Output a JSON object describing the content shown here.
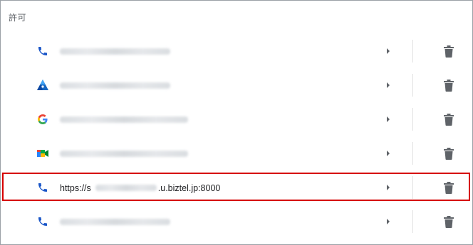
{
  "section": {
    "label": "許可"
  },
  "rows": [
    {
      "icon": "phone-icon",
      "url_prefix": "",
      "url_suffix": "",
      "redacted": true
    },
    {
      "icon": "pen-triangle-icon",
      "url_prefix": "",
      "url_suffix": "",
      "redacted": true
    },
    {
      "icon": "google-g-icon",
      "url_prefix": "",
      "url_suffix": "",
      "redacted": true
    },
    {
      "icon": "meet-camera-icon",
      "url_prefix": "",
      "url_suffix": "",
      "redacted": true
    },
    {
      "icon": "phone-icon",
      "url_prefix": "https://s",
      "url_suffix": ".u.biztel.jp:8000",
      "redacted": false,
      "highlighted": true
    },
    {
      "icon": "phone-icon",
      "url_prefix": "",
      "url_suffix": "",
      "redacted": true
    }
  ],
  "colors": {
    "phone_blue": "#1a56c8",
    "icon_gray": "#5f6368",
    "highlight_red": "#d60000",
    "separator": "#e0e0e0"
  }
}
